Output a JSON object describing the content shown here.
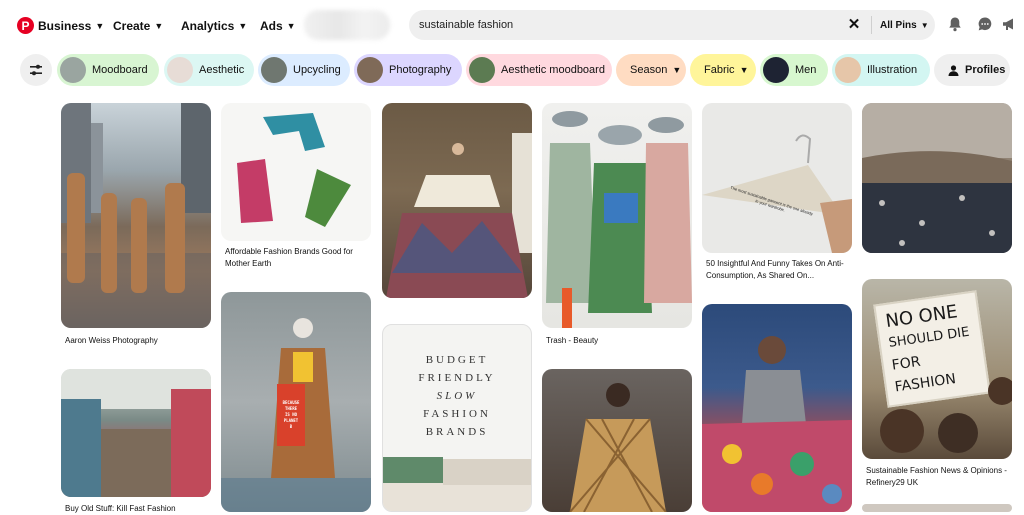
{
  "header": {
    "logo_letter": "P",
    "nav": [
      {
        "label": "Business"
      },
      {
        "label": "Create"
      },
      {
        "label": "Analytics"
      },
      {
        "label": "Ads"
      }
    ]
  },
  "search": {
    "value": "sustainable fashion",
    "scope": "All Pins"
  },
  "chips": [
    {
      "label": "Moodboard",
      "bg": "#d8f5d2",
      "thumb": "#9aa5a0"
    },
    {
      "label": "Aesthetic",
      "bg": "#dcf7f3",
      "thumb": "#e7dcd6"
    },
    {
      "label": "Upcycling",
      "bg": "#dcecff",
      "thumb": "#6f7770"
    },
    {
      "label": "Photography",
      "bg": "#dcd6ff",
      "thumb": "#7f6a58"
    },
    {
      "label": "Aesthetic moodboard",
      "bg": "#ffd9df",
      "thumb": "#5c7b52"
    },
    {
      "label": "Season",
      "bg": "#ffdcc2"
    },
    {
      "label": "Fabric",
      "bg": "#fff59a"
    },
    {
      "label": "Men",
      "bg": "#d7f7cf",
      "thumb": "#1e2333"
    },
    {
      "label": "Illustration",
      "bg": "#d3f6f2",
      "thumb": "#e6c6a9"
    },
    {
      "label": "Profiles",
      "bg": "#efefef"
    }
  ],
  "pins": {
    "aaron_weiss": "Aaron Weiss Photography",
    "affordable": "Affordable Fashion Brands Good for Mother Earth",
    "trash_beauty": "Trash - Beauty",
    "insightful": "50 Insightful And Funny Takes On Anti-Consumption, As Shared On...",
    "refinery": "Sustainable Fashion News & Opinions - Refinery29 UK",
    "buy_old": "Buy Old Stuff: Kill Fast Fashion"
  },
  "book_cover": [
    "BUDGET",
    "FRIENDLY",
    "SLOW",
    "FASHION",
    "BRANDS"
  ],
  "protest_sign": [
    "NO ONE",
    "SHOULD DIE",
    "FOR FASHION"
  ],
  "coat_sign": [
    "BECAUSE",
    "THERE",
    "IS NO",
    "PLANET",
    "B"
  ],
  "hanger_text": "The most sustainable garment is the one already in your wardrobe."
}
